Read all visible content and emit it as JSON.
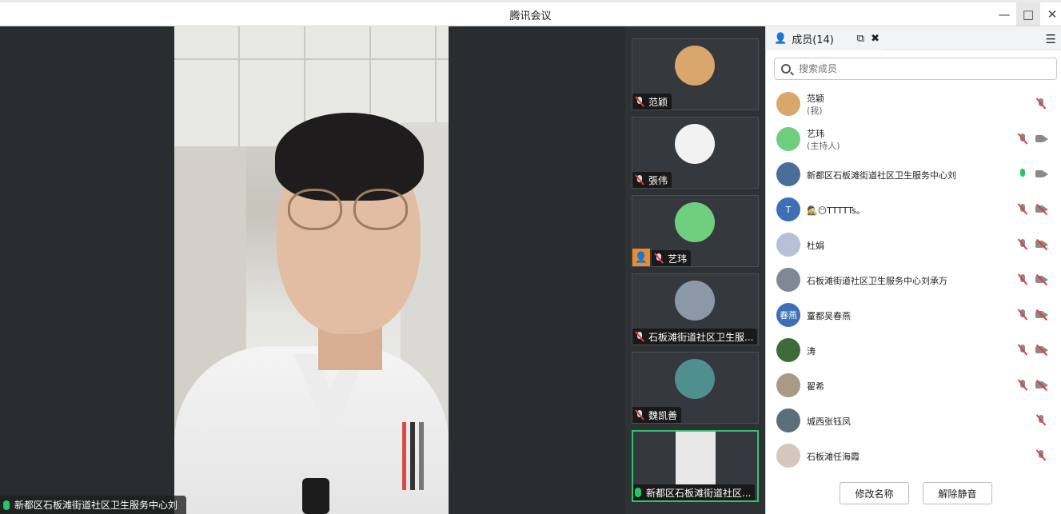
{
  "window": {
    "title": "腾讯会议",
    "minimize_icon": "minimize-icon",
    "maximize_icon": "maximize-icon",
    "close_icon": "close-icon"
  },
  "main_video": {
    "speaker_name": "新都区石板滩街道社区卫生服务中心刘",
    "mic_state": "on"
  },
  "tiles": [
    {
      "name": "范颖",
      "mic": "muted",
      "avatar_color": "#d9a66b",
      "host": false
    },
    {
      "name": "張伟",
      "mic": "muted",
      "avatar_color": "#f2f2f2",
      "host": false
    },
    {
      "name": "艺玮",
      "mic": "muted",
      "avatar_color": "#6fcf7f",
      "host": true
    },
    {
      "name": "石板滩街道社区卫生服...",
      "mic": "muted",
      "avatar_color": "#8a98a8",
      "host": false
    },
    {
      "name": "魏凯善",
      "mic": "muted",
      "avatar_color": "#4f8f8f",
      "host": false
    },
    {
      "name": "新都区石板滩街道社区...",
      "mic": "on",
      "avatar_color": "#e8e8e8",
      "host": false,
      "active": true
    }
  ],
  "panel": {
    "tab_label": "成员(14)",
    "popout_icon": "popout-icon",
    "close_icon": "close-icon",
    "menu_icon": "menu-icon",
    "search_placeholder": "搜索成员",
    "members": [
      {
        "name": "范颖",
        "sub": "(我)",
        "avatar_color": "#d9a66b",
        "avatar_text": "",
        "mic": "muted",
        "cam": "none"
      },
      {
        "name": "艺玮",
        "sub": "(主持人)",
        "avatar_color": "#6fcf7f",
        "avatar_text": "",
        "mic": "muted",
        "cam": "on"
      },
      {
        "name": "新都区石板滩街道社区卫生服务中心刘",
        "sub": "",
        "avatar_color": "#4a6e9a",
        "avatar_text": "",
        "mic": "on",
        "cam": "on"
      },
      {
        "name": "🕵️😶TTTTTs。",
        "sub": "",
        "avatar_color": "#3d6fb6",
        "avatar_text": "T",
        "mic": "muted",
        "cam": "off"
      },
      {
        "name": "杜娟",
        "sub": "",
        "avatar_color": "#b7c0d6",
        "avatar_text": "",
        "mic": "muted",
        "cam": "off"
      },
      {
        "name": "石板滩街道社区卫生服务中心刘承万",
        "sub": "",
        "avatar_color": "#7f8894",
        "avatar_text": "",
        "mic": "muted",
        "cam": "off"
      },
      {
        "name": "罿都吴春燕",
        "sub": "",
        "avatar_color": "#3d6fb6",
        "avatar_text": "春燕",
        "mic": "muted",
        "cam": "off"
      },
      {
        "name": "涛",
        "sub": "",
        "avatar_color": "#3f6a3a",
        "avatar_text": "",
        "mic": "muted",
        "cam": "off"
      },
      {
        "name": "翟希",
        "sub": "",
        "avatar_color": "#a99a86",
        "avatar_text": "",
        "mic": "muted",
        "cam": "off"
      },
      {
        "name": "城西张钰凤",
        "sub": "",
        "avatar_color": "#5b6f7a",
        "avatar_text": "",
        "mic": "muted",
        "cam": "none"
      },
      {
        "name": "石板滩任海霞",
        "sub": "",
        "avatar_color": "#d6c7bd",
        "avatar_text": "",
        "mic": "muted",
        "cam": "none"
      }
    ],
    "rename_button": "修改名称",
    "unmute_button": "解除静音"
  }
}
